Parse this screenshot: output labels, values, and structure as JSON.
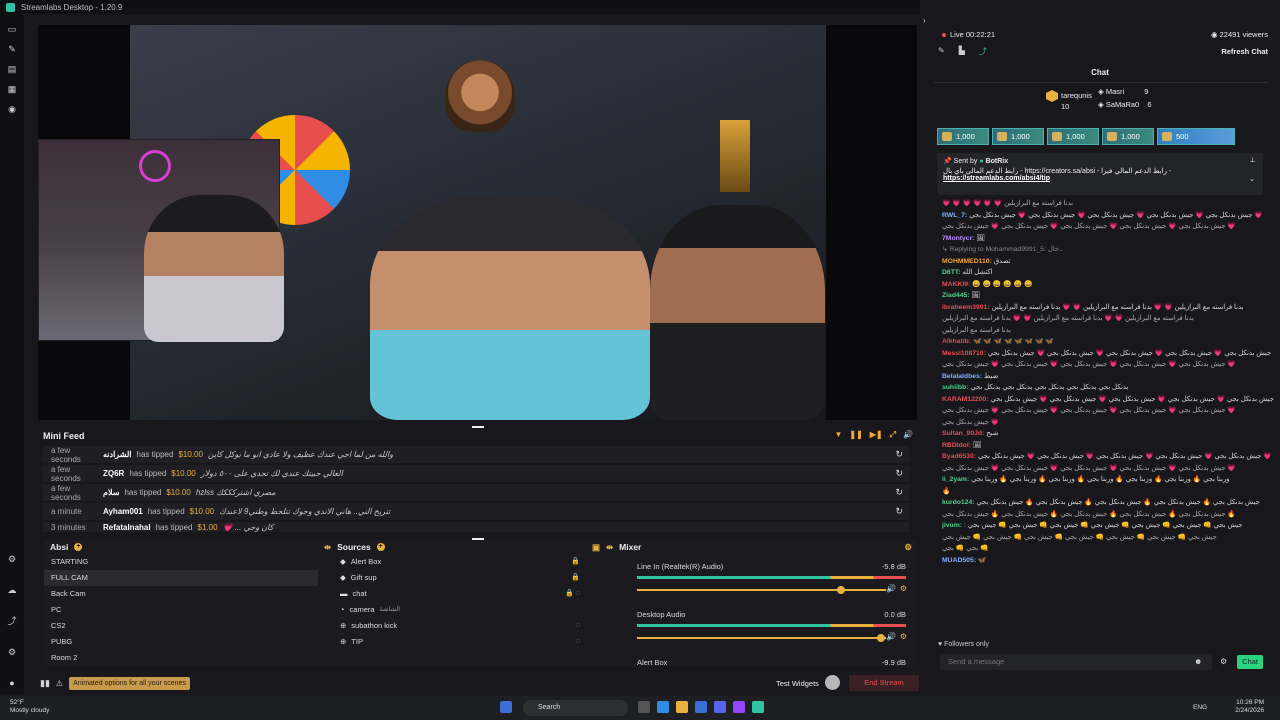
{
  "window": {
    "title": "Streamlabs Desktop - 1.20.9"
  },
  "left_rail": {
    "icons": [
      "record-icon",
      "edit-icon",
      "store-icon",
      "layout-icon",
      "theme-icon"
    ],
    "bottom_icons": [
      "settings-icon",
      "cloud-icon",
      "share-icon",
      "gear-icon",
      "profile-icon"
    ]
  },
  "mini_feed": {
    "title": "Mini Feed",
    "rows": [
      {
        "time": "a few seconds",
        "user": "الشرادنه",
        "action": "has tipped",
        "amount": "$10.00",
        "message": "والله من لما اجي عندك عظيف ولا عادي انو ما بوكل كاين"
      },
      {
        "time": "a few seconds",
        "user": "ZQ6R",
        "action": "has tipped",
        "amount": "$10.00",
        "message": "الغالي حبيتك عندي لك تحدي على ٥٠٠ دولار"
      },
      {
        "time": "a few seconds",
        "user": "سلام",
        "action": "has tipped",
        "amount": "$10.00",
        "message": "hzlss مصري اشتركككك"
      },
      {
        "time": "a minute",
        "user": "Ayham001",
        "action": "has tipped",
        "amount": "$10.00",
        "message": "تتريح الني.. هاني الاندي وجوك تتلحط وطني9 لاعندك"
      },
      {
        "time": "3 minutes",
        "user": "Refatalnahal",
        "action": "has tipped",
        "amount": "$1.00",
        "message": "💗 ... كان وحي"
      }
    ]
  },
  "scenes": {
    "title": "Absi",
    "items": [
      "STARTING",
      "FULL CAM",
      "Back Cam",
      "PC",
      "CS2",
      "PUBG",
      "Room 2"
    ],
    "active": "FULL CAM"
  },
  "sources": {
    "title": "Sources",
    "items": [
      {
        "icon": "alert-icon",
        "label": "Alert Box"
      },
      {
        "icon": "gift-icon",
        "label": "Gift sup"
      },
      {
        "icon": "folder-icon",
        "label": "chat"
      },
      {
        "icon": "camera-icon",
        "label": "camera",
        "sub": "الشاشة"
      },
      {
        "icon": "globe-icon",
        "label": "subathon kick"
      },
      {
        "icon": "globe-icon",
        "label": "TIP"
      }
    ]
  },
  "mixer": {
    "title": "Mixer",
    "items": [
      {
        "name": "Line In (Realtek(R) Audio)",
        "db": "-5.8 dB",
        "level": 0.82
      },
      {
        "name": "Desktop Audio",
        "db": "0.0 dB",
        "level": 0.98
      },
      {
        "name": "Alert Box",
        "db": "-9.9 dB",
        "level": 0.7
      }
    ]
  },
  "bottom_bar": {
    "hint": "Animated options for all your scenes",
    "test_widgets": "Test Widgets",
    "end_stream": "End Stream"
  },
  "chat": {
    "live": "Live 00:22:21",
    "viewers": "22491 viewers",
    "refresh": "Refresh Chat",
    "title": "Chat",
    "leaderboard": {
      "first": {
        "name": "tarequnis",
        "count": "10"
      },
      "second": {
        "name": "Masri",
        "count": "9"
      },
      "third": {
        "name": "SaMaRa0",
        "count": "6"
      }
    },
    "gifts": [
      "1,000",
      "1,000",
      "1,000",
      "1,000",
      "500"
    ],
    "pinned": {
      "sent_by": "Sent by",
      "bot": "BotRix",
      "line1": "رابط الدعم المالي باي بال - https://creators.sa/absi - رابط الدعم المالي فيزا -",
      "link1": "https://creators.sa/absi",
      "link2": "https://streamlabs.com/absi4/tip"
    },
    "messages": [
      {
        "user": "",
        "color": "#aaa",
        "text": "💗 💗 💗 💗 💗 💗 بدنا فراسته مع البرازيلين"
      },
      {
        "user": "RWL_7:",
        "color": "#7fb3ff",
        "text": "جيش بدنكل بجي 💗 جيش بدنكل بجي 💗 جيش بدنكل بجي 💗 جيش بدنكل بجي 💗 جيش بدنكل بجي 💗"
      },
      {
        "user": "",
        "color": "#aaa",
        "text": "جيش بدنكل بجي 💗 جيش بدنكل بجي 💗 جيش بدنكل بجي 💗 جيش بدنكل بجي 💗 جيش بدنكل بجي 💗"
      },
      {
        "user": "7Montycr:",
        "color": "#c08bff",
        "text": "🖼"
      },
      {
        "user": "",
        "color": "#888",
        "text": "↳ Replying to Mohammad9991_5: خال.."
      },
      {
        "user": "MOHMMED110:",
        "color": "#f0a63a",
        "text": "تصدق"
      },
      {
        "user": "D6TT:",
        "color": "#4fd18b",
        "text": "اكتشل الله"
      },
      {
        "user": "MAKKI9:",
        "color": "#e84e4e",
        "text": "😄 😄 😄 😄 😄 😄"
      },
      {
        "user": "Ziad445:",
        "color": "#4fd18b",
        "text": "🖼"
      },
      {
        "user": "ibraheem3991:",
        "color": "#e84e4e",
        "text": "بدنا فراسته مع البرازيلين 💗 💗 بدنا فراسته مع البرازيلين 💗 💗 بدنا فراسته مع البرازيلين"
      },
      {
        "user": "",
        "color": "#aaa",
        "text": "بدنا فراسته مع البرازيلين 💗 💗 بدنا فراسته مع البرازيلين 💗 💗 بدنا فراسته مع البرازيلين"
      },
      {
        "user": "",
        "color": "#aaa",
        "text": "بدنا فراسته مع البرازيلين"
      },
      {
        "user": "Alkhatib:",
        "color": "#e84e4e",
        "text": "🦋 🦋 🦋 🦋 🦋 🦋 🦋 🦋"
      },
      {
        "user": "Messi108710:",
        "color": "#e84e4e",
        "text": "جيش بدنكل بجي 💗 جيش بدنكل بجي 💗 جيش بدنكل بجي 💗 جيش بدنكل بجي 💗 جيش بدنكل بجي 💗"
      },
      {
        "user": "",
        "color": "#aaa",
        "text": "جيش بدنكل بجي 💗 جيش بدنكل بجي 💗 جيش بدنكل بجي 💗 جيش بدنكل بجي 💗 جيش بدنكل بجي 💗"
      },
      {
        "user": "Belalaldbes:",
        "color": "#7fb3ff",
        "text": "ضبط"
      },
      {
        "user": "suhiibb:",
        "color": "#4fd18b",
        "text": "بدنكل بجي بدنكل بجي بدنكل بجي بدنكل بجي بدنكل بجي"
      },
      {
        "user": "KARAM12200:",
        "color": "#e84e4e",
        "text": "جيش بدنكل بجي 💗 جيش بدنكل بجي 💗 جيش بدنكل بجي 💗 جيش بدنكل بجي 💗 جيش بدنكل بجي 💗"
      },
      {
        "user": "",
        "color": "#aaa",
        "text": "جيش بدنكل بجي 💗 جيش بدنكل بجي 💗 جيش بدنكل بجي 💗 جيش بدنكل بجي 💗 جيش بدنكل بجي 💗"
      },
      {
        "user": "",
        "color": "#aaa",
        "text": "جيش بدنكل بجي 💗"
      },
      {
        "user": "Sultan_90Jd:",
        "color": "#e84e4e",
        "text": "شبح"
      },
      {
        "user": "RBDIdol:",
        "color": "#e84e4e",
        "text": "🖼"
      },
      {
        "user": "Byad6530:",
        "color": "#e84e4e",
        "text": "جيش بدنكل بجي 💗 جيش بدنكل بجي 💗 جيش بدنكل بجي 💗 جيش بدنكل بجي 💗 جيش بدنكل بجي 💗"
      },
      {
        "user": "",
        "color": "#aaa",
        "text": "جيش بدنكل بجي 💗 جيش بدنكل بجي 💗 جيش بدنكل بجي 💗 جيش بدنكل بجي 💗 جيش بدنكل بجي 💗"
      },
      {
        "user": "ii_2yam:",
        "color": "#4fd18b",
        "text": "وربنا بجي 🔥 وربنا بجي 🔥 وربنا بجي 🔥 وربنا بجي 🔥 وربنا بجي 🔥 وربنا بجي 🔥 وربنا بجي"
      },
      {
        "user": "",
        "color": "#aaa",
        "text": "🔥"
      },
      {
        "user": "kurdo124:",
        "color": "#4fd18b",
        "text": "جيش بدنكل بجي 🔥 جيش بدنكل بجي 🔥 جيش بدنكل بجي 🔥 جيش بدنكل بجي 🔥 جيش بدنكل بجي"
      },
      {
        "user": "",
        "color": "#aaa",
        "text": "جيش بدنكل بجي 🔥 جيش بدنكل بجي 🔥 جيش بدنكل بجي 🔥 جيش بدنكل بجي 🔥 جيش بدنكل بجي 🔥"
      },
      {
        "user": "jivum:",
        "color": "#4fd18b",
        "text": ": جيش بجي 👊 جيش بجي 👊 جيش بجي 👊 جيش بجي 👊 جيش بجي 👊 جيش بجي 👊 جيش بجي"
      },
      {
        "user": "",
        "color": "#aaa",
        "text": "جيش بجي 👊 جيش بجي 👊 جيش بجي 👊 جيش بجي 👊 جيش بجي 👊 جيش بجي 👊 جيش بجي"
      },
      {
        "user": "",
        "color": "#aaa",
        "text": "بجي 👊 بجي 👊"
      },
      {
        "user": "MUAD505:",
        "color": "#7fb3ff",
        "text": "🦋"
      }
    ],
    "followers_only": "Followers only",
    "placeholder": "Send a message",
    "send": "Chat"
  },
  "taskbar": {
    "weather_temp": "52°F",
    "weather_desc": "Mostly cloudy",
    "search": "Search",
    "lang": "ENG",
    "time": "10:26 PM",
    "date": "2/24/2026"
  }
}
